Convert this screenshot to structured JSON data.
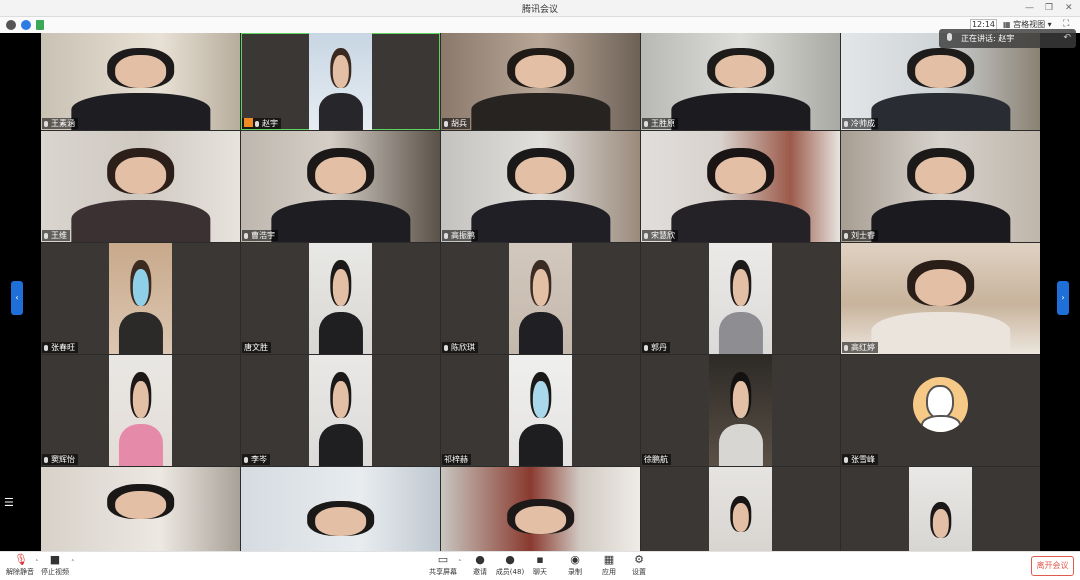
{
  "window": {
    "title": "腾讯会议"
  },
  "top": {
    "time": "12:14",
    "layout_label": "宫格视图"
  },
  "speaking": {
    "label": "正在讲话: 赵宇"
  },
  "participants": [
    {
      "name": "王素涵"
    },
    {
      "name": "赵宇"
    },
    {
      "name": "胡兵"
    },
    {
      "name": "王胜原"
    },
    {
      "name": "冷帅成"
    },
    {
      "name": "王维"
    },
    {
      "name": "曹浩宇"
    },
    {
      "name": "高振鹏"
    },
    {
      "name": "宋慧欣"
    },
    {
      "name": "刘士睿"
    },
    {
      "name": "张春旺"
    },
    {
      "name": "唐文胜"
    },
    {
      "name": "陈欣琪"
    },
    {
      "name": "郭丹"
    },
    {
      "name": "高红婷"
    },
    {
      "name": "窦辉怡"
    },
    {
      "name": "李岑"
    },
    {
      "name": "祁梓赫"
    },
    {
      "name": "徐鹏航"
    },
    {
      "name": "张雪峰"
    },
    {
      "name": ""
    },
    {
      "name": ""
    },
    {
      "name": ""
    },
    {
      "name": ""
    },
    {
      "name": ""
    }
  ],
  "toolbar": {
    "unmute": "解除静音",
    "stop_video": "停止视频",
    "share_screen": "共享屏幕",
    "invite": "邀请",
    "members": "成员(48)",
    "chat": "聊天",
    "record": "录制",
    "apps": "应用",
    "settings": "设置",
    "leave": "离开会议"
  },
  "colors": {
    "accent": "#1f6fd9",
    "leave": "#e05a4f",
    "active": "#5fd35f",
    "host": "#f08a24"
  }
}
